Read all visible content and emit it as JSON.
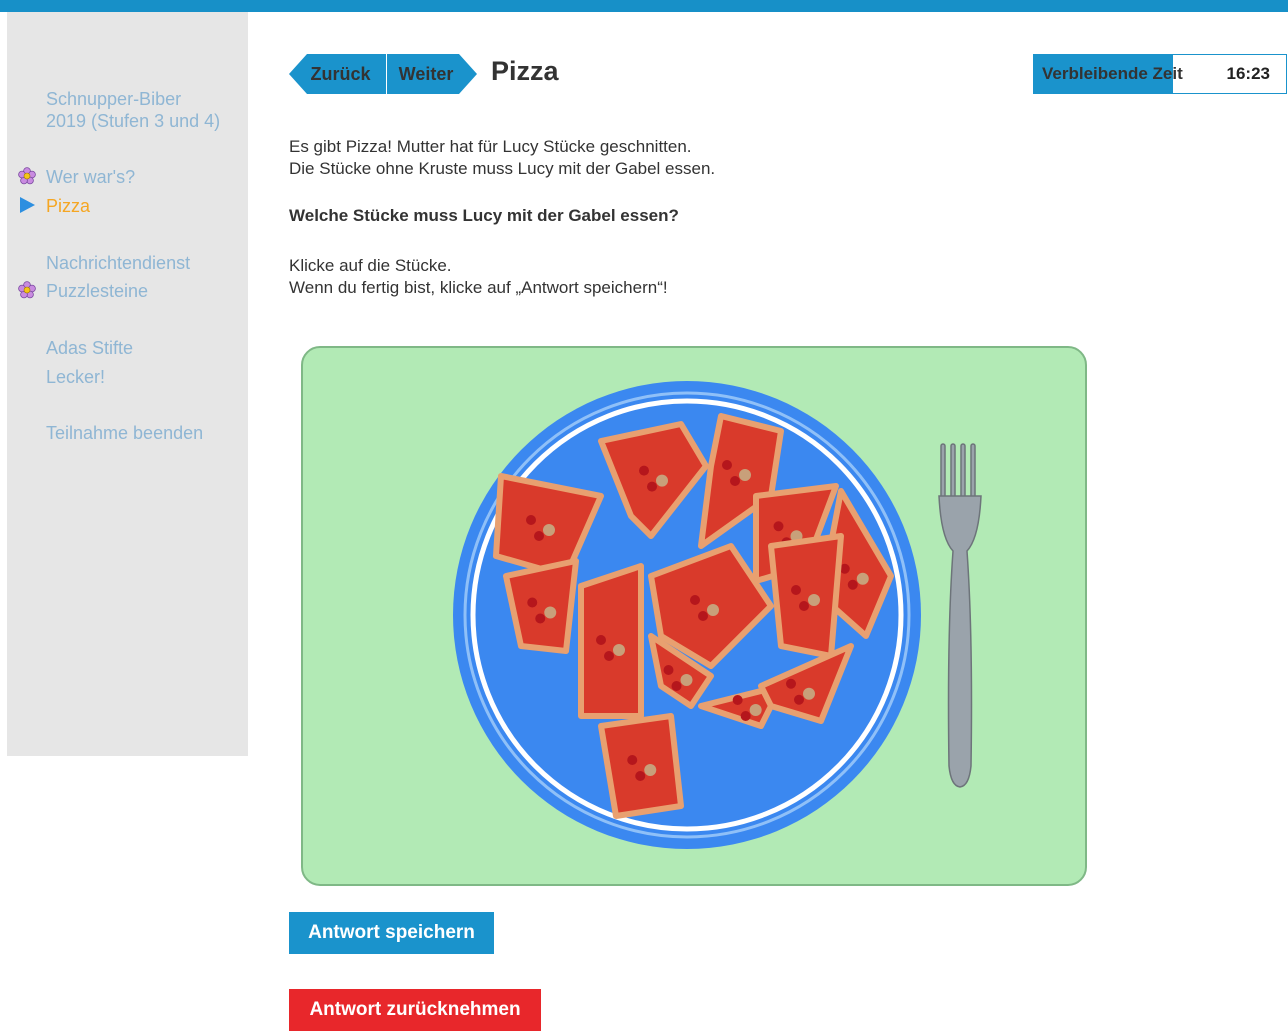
{
  "header": {
    "back_label": "Zurück",
    "next_label": "Weiter",
    "title": "Pizza",
    "timer_label": "Verbleibende Zeit",
    "timer_value": "16:23",
    "timer_fraction": 0.55,
    "accent_color": "#1a93cc"
  },
  "sidebar": {
    "contest_title_line1": "Schnupper-Biber",
    "contest_title_line2": "2019 (Stufen 3 und 4)",
    "items": [
      {
        "label": "Wer war's?",
        "icon": "flower-icon",
        "state": "answered"
      },
      {
        "label": "Pizza",
        "icon": "play-arrow-icon",
        "state": "current"
      },
      {
        "label": "Nachrichtendienst",
        "icon": "",
        "state": "open"
      },
      {
        "label": "Puzzlesteine",
        "icon": "flower-icon",
        "state": "answered"
      },
      {
        "label": "Adas Stifte",
        "icon": "",
        "state": "open"
      },
      {
        "label": "Lecker!",
        "icon": "",
        "state": "open"
      },
      {
        "label": "Teilnahme beenden",
        "icon": "",
        "state": "open"
      }
    ]
  },
  "task": {
    "intro_line1": "Es gibt Pizza! Mutter hat für Lucy Stücke geschnitten.",
    "intro_line2": "Die Stücke ohne Kruste muss Lucy mit der Gabel essen.",
    "question": "Welche Stücke muss Lucy mit der Gabel essen?",
    "instruction_line1": "Klicke auf die Stücke.",
    "instruction_line2": "Wenn du fertig bist, klicke auf „Antwort speichern“!"
  },
  "actions": {
    "save_label": "Antwort speichern",
    "reset_label": "Antwort zurücknehmen"
  }
}
